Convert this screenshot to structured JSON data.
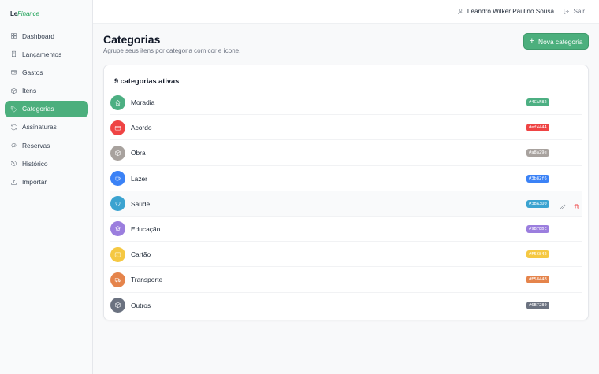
{
  "brand": {
    "logo_main": "Le",
    "logo_accent": "Finance"
  },
  "sidebar": {
    "items": [
      {
        "label": "Dashboard",
        "icon": "dashboard-icon",
        "active": false
      },
      {
        "label": "Lançamentos",
        "icon": "receipt-icon",
        "active": false
      },
      {
        "label": "Gastos",
        "icon": "wallet-icon",
        "active": false
      },
      {
        "label": "Itens",
        "icon": "box-icon",
        "active": false
      },
      {
        "label": "Categorias",
        "icon": "tag-icon",
        "active": true
      },
      {
        "label": "Assinaturas",
        "icon": "refresh-icon",
        "active": false
      },
      {
        "label": "Reservas",
        "icon": "piggy-bank-icon",
        "active": false
      },
      {
        "label": "Histórico",
        "icon": "history-icon",
        "active": false
      },
      {
        "label": "Importar",
        "icon": "upload-icon",
        "active": false
      }
    ]
  },
  "header": {
    "user_name": "Leandro Wilker Paulino Sousa",
    "logout_label": "Sair"
  },
  "main": {
    "title": "Categorias",
    "subtitle": "Agrupe seus itens por categoria com cor e ícone.",
    "new_button_label": "Nova categoria",
    "count_label": "9 categorias ativas",
    "categories": [
      {
        "name": "Moradia",
        "color": "#4CAF82",
        "icon": "home-icon"
      },
      {
        "name": "Acordo",
        "color": "#ef4444",
        "icon": "credit-card-icon"
      },
      {
        "name": "Obra",
        "color": "#a8a29e",
        "icon": "box-icon"
      },
      {
        "name": "Lazer",
        "color": "#3b82f6",
        "icon": "coffee-icon"
      },
      {
        "name": "Saúde",
        "color": "#3BA3D0",
        "icon": "heart-icon"
      },
      {
        "name": "Educação",
        "color": "#9B7EDE",
        "icon": "graduation-cap-icon"
      },
      {
        "name": "Cartão",
        "color": "#F5C842",
        "icon": "card-icon"
      },
      {
        "name": "Transporte",
        "color": "#E5844B",
        "icon": "truck-icon"
      },
      {
        "name": "Outros",
        "color": "#6B7280",
        "icon": "package-icon"
      }
    ]
  }
}
